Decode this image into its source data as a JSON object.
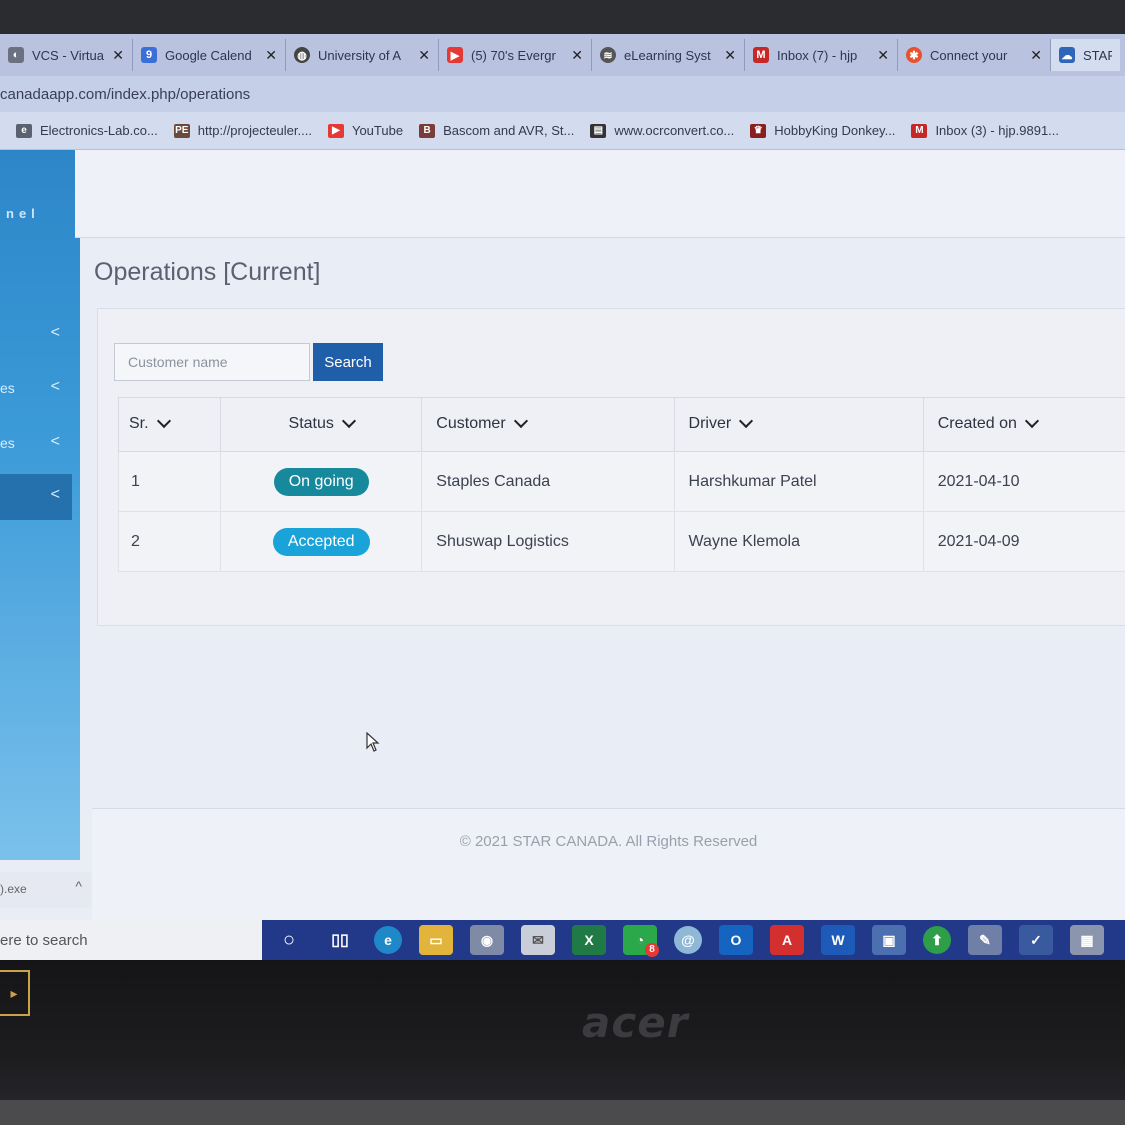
{
  "browser": {
    "tabs": [
      {
        "label": "VCS - Virtual C",
        "icon": "globe-icon",
        "color": "#6b7180",
        "active": false
      },
      {
        "label": "Google Calend",
        "icon": "calendar-icon",
        "color": "#3a6fd8",
        "active": false
      },
      {
        "label": "University of A",
        "icon": "globe-icon",
        "color": "#444",
        "active": false
      },
      {
        "label": "(5) 70's Evergr",
        "icon": "youtube-icon",
        "color": "#e53935",
        "active": false
      },
      {
        "label": "eLearning Syst",
        "icon": "elearning-icon",
        "color": "#555",
        "active": false
      },
      {
        "label": "Inbox (7) - hjp",
        "icon": "gmail-icon",
        "color": "#c62828",
        "active": false
      },
      {
        "label": "Connect your",
        "icon": "gear-icon",
        "color": "#e8502e",
        "active": false
      },
      {
        "label": "STAR",
        "icon": "cloud-icon",
        "color": "#2f66b8",
        "active": true
      }
    ],
    "url": "canadaapp.com/index.php/operations",
    "bookmarks": [
      {
        "label": "Electronics-Lab.co...",
        "icon": "electronics-icon",
        "color": "#5a6272"
      },
      {
        "label": "http://projecteuler....",
        "icon": "projecteuler-icon",
        "color": "#6a4a3a"
      },
      {
        "label": "YouTube",
        "icon": "youtube-icon",
        "color": "#e53935"
      },
      {
        "label": "Bascom and AVR, St...",
        "icon": "bascom-icon",
        "color": "#7a3b3b"
      },
      {
        "label": "www.ocrconvert.co...",
        "icon": "ocr-icon",
        "color": "#333"
      },
      {
        "label": "HobbyKing Donkey...",
        "icon": "hobbyking-icon",
        "color": "#8a1f1f"
      },
      {
        "label": "Inbox (3) - hjp.9891...",
        "icon": "gmail-icon",
        "color": "#c62828"
      }
    ]
  },
  "sidebar": {
    "brand": "nel",
    "items": [
      {
        "label": "",
        "chevron": "<",
        "active": false
      },
      {
        "label": "es",
        "chevron": "<",
        "active": false
      },
      {
        "label": "es",
        "chevron": "<",
        "active": false
      },
      {
        "label": "",
        "chevron": "<",
        "active": true
      }
    ]
  },
  "page": {
    "title": "Operations [Current]",
    "search": {
      "placeholder": "Customer name",
      "button": "Search"
    },
    "table": {
      "headers": [
        "Sr.",
        "Status",
        "Customer",
        "Driver",
        "Created on"
      ],
      "rows": [
        {
          "sr": "1",
          "status": "On going",
          "status_color": "#17899c",
          "customer": "Staples Canada",
          "driver": "Harshkumar Patel",
          "created_on": "2021-04-10"
        },
        {
          "sr": "2",
          "status": "Accepted",
          "status_color": "#1aa3d8",
          "customer": "Shuswap Logistics",
          "driver": "Wayne Klemola",
          "created_on": "2021-04-09"
        }
      ]
    },
    "footer": "© 2021 STAR CANADA. All Rights Reserved"
  },
  "downloads": {
    "file": ").exe",
    "chevron": "^"
  },
  "taskbar": {
    "search_text": "ere to search",
    "icons": [
      "cortana-icon",
      "task-view-icon",
      "edge-icon",
      "file-explorer-icon",
      "chrome-icon",
      "mail-icon",
      "excel-icon",
      "whatsapp-icon",
      "browser-icon",
      "outlook-icon",
      "acrobat-icon",
      "word-icon",
      "rdp-icon",
      "upload-icon",
      "paint-icon",
      "todo-icon",
      "calculator-icon"
    ],
    "whatsapp_badge": "8"
  },
  "laptop": {
    "brand": "acer"
  }
}
